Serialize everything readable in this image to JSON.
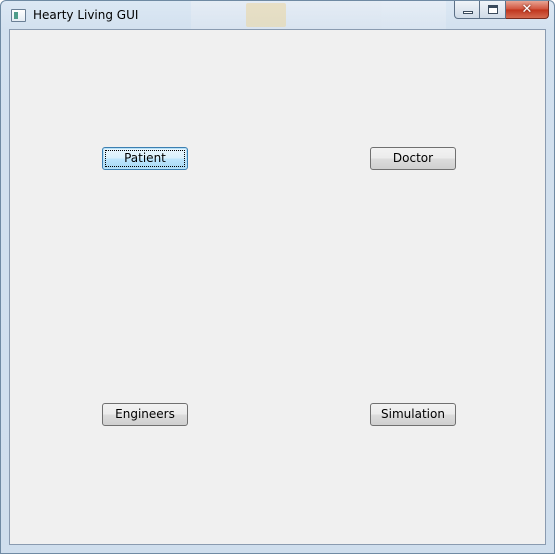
{
  "window": {
    "title": "Hearty Living GUI",
    "icon": "app-window-icon",
    "caption_buttons": {
      "minimize": "minimize-icon",
      "maximize": "maximize-icon",
      "close": "close-icon",
      "close_glyph": "✕"
    }
  },
  "buttons": {
    "patient": "Patient",
    "doctor": "Doctor",
    "engineers": "Engineers",
    "simulation": "Simulation"
  },
  "focused_button": "patient",
  "colors": {
    "client_background": "#f0f0f0",
    "focus_border": "#3c7fb1",
    "close_button": "#c0341c"
  }
}
